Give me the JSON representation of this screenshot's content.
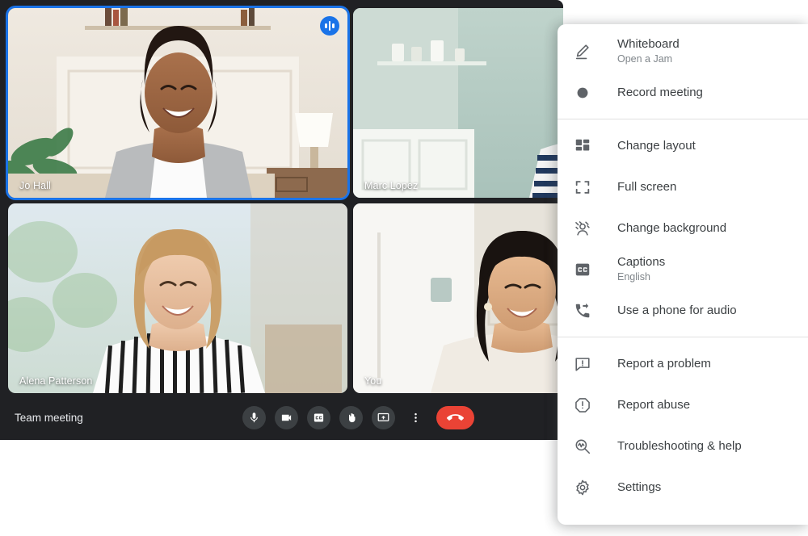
{
  "app": {
    "meeting_title": "Team meeting"
  },
  "tiles": [
    {
      "name": "Jo Hall",
      "badge": "speaking-indicator-icon",
      "active": true,
      "scene": "woman smiling in living room with bookshelf and lamp"
    },
    {
      "name": "Marc Lopez",
      "badge": "mic-off-icon",
      "active": false,
      "scene": "man smiling in kitchen with striped shirt"
    },
    {
      "name": "Alena Patterson",
      "badge": "",
      "active": false,
      "scene": "woman in striped blouse smiling outdoors"
    },
    {
      "name": "You",
      "badge": "",
      "active": false,
      "scene": "woman in cream top smiling in bright room"
    }
  ],
  "controls": [
    {
      "name": "microphone-button",
      "icon": "mic-icon",
      "style": "dark"
    },
    {
      "name": "camera-button",
      "icon": "video-camera-icon",
      "style": "dark"
    },
    {
      "name": "captions-button",
      "icon": "closed-caption-icon",
      "style": "dark"
    },
    {
      "name": "raise-hand-button",
      "icon": "hand-icon",
      "style": "dark"
    },
    {
      "name": "present-now-button",
      "icon": "present-screen-icon",
      "style": "dark"
    },
    {
      "name": "more-options-button",
      "icon": "more-vertical-icon",
      "style": "plain"
    },
    {
      "name": "leave-call-button",
      "icon": "hangup-phone-icon",
      "style": "hangup"
    }
  ],
  "menu": {
    "groups": [
      {
        "items": [
          {
            "label": "Whiteboard",
            "sub": "Open a Jam",
            "icon": "pen-underline-icon",
            "name": "menu-item-whiteboard"
          },
          {
            "label": "Record meeting",
            "sub": "",
            "icon": "record-circle-icon",
            "name": "menu-item-record-meeting"
          }
        ]
      },
      {
        "items": [
          {
            "label": "Change layout",
            "sub": "",
            "icon": "layout-grid-icon",
            "name": "menu-item-change-layout"
          },
          {
            "label": "Full screen",
            "sub": "",
            "icon": "fullscreen-icon",
            "name": "menu-item-full-screen"
          },
          {
            "label": "Change background",
            "sub": "",
            "icon": "change-background-icon",
            "name": "menu-item-change-background"
          },
          {
            "label": "Captions",
            "sub": "English",
            "icon": "closed-caption-icon",
            "name": "menu-item-captions"
          },
          {
            "label": "Use a phone for audio",
            "sub": "",
            "icon": "phone-forward-icon",
            "name": "menu-item-use-phone-for-audio"
          }
        ]
      },
      {
        "items": [
          {
            "label": "Report a problem",
            "sub": "",
            "icon": "feedback-icon",
            "name": "menu-item-report-a-problem"
          },
          {
            "label": "Report abuse",
            "sub": "",
            "icon": "report-abuse-icon",
            "name": "menu-item-report-abuse"
          },
          {
            "label": "Troubleshooting & help",
            "sub": "",
            "icon": "troubleshoot-icon",
            "name": "menu-item-troubleshooting-help"
          },
          {
            "label": "Settings",
            "sub": "",
            "icon": "gear-icon",
            "name": "menu-item-settings"
          }
        ]
      }
    ]
  },
  "colors": {
    "accent_blue": "#1a73e8",
    "hangup_red": "#ea4335",
    "app_dark": "#202124",
    "menu_bg": "#ffffff",
    "icon_gray": "#5f6368",
    "text_primary": "#3c4043",
    "text_secondary": "#80868b"
  }
}
